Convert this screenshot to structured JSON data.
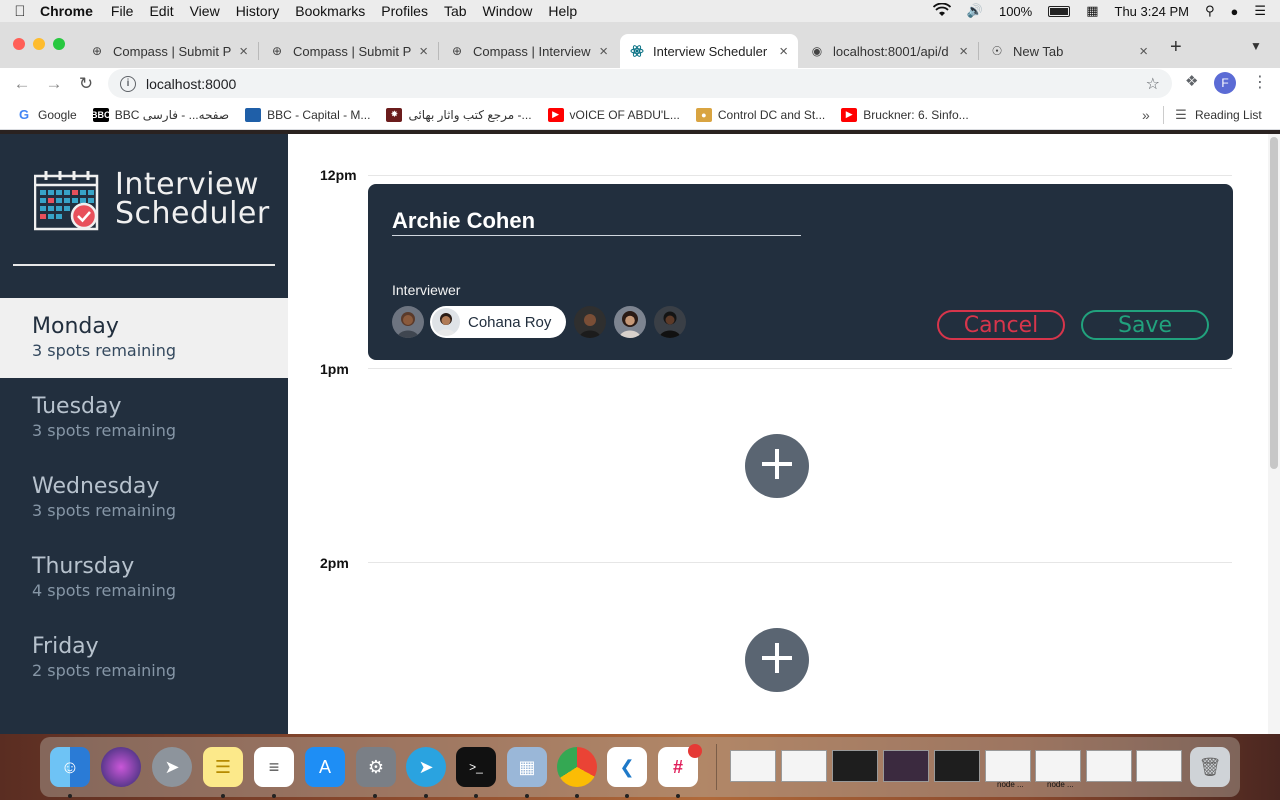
{
  "menubar": {
    "app": "Chrome",
    "items": [
      "File",
      "Edit",
      "View",
      "History",
      "Bookmarks",
      "Profiles",
      "Tab",
      "Window",
      "Help"
    ],
    "battery": "100%",
    "clock": "Thu 3:24 PM"
  },
  "tabs": [
    {
      "title": "Compass | Submit P",
      "icon": "compass-icon"
    },
    {
      "title": "Compass | Submit P",
      "icon": "compass-icon"
    },
    {
      "title": "Compass | Interview",
      "icon": "compass-icon"
    },
    {
      "title": "Interview Scheduler",
      "icon": "react-icon",
      "active": true
    },
    {
      "title": "localhost:8001/api/d",
      "icon": "globe-icon"
    },
    {
      "title": "New Tab",
      "icon": "chrome-icon"
    }
  ],
  "toolbar": {
    "url": "localhost:8000",
    "profile_initial": "F"
  },
  "bookmarks": [
    {
      "label": "Google",
      "icon": "google-icon",
      "color": "#4285f4"
    },
    {
      "label": "BBC صفحه... - فارسی",
      "icon": "bbc-icon",
      "color": "#000000"
    },
    {
      "label": "BBC - Capital - M...",
      "icon": "bbc-capital-icon",
      "color": "#1f5fa8"
    },
    {
      "label": "مرجع كتب واثار بهائى -...",
      "icon": "bahai-icon",
      "color": "#6b1c1c"
    },
    {
      "label": "vOICE OF ABDU'L...",
      "icon": "youtube-icon",
      "color": "#ff0000"
    },
    {
      "label": "Control DC and St...",
      "icon": "control-icon",
      "color": "#d9a441"
    },
    {
      "label": "Bruckner: 6. Sinfo...",
      "icon": "youtube-icon",
      "color": "#ff0000"
    }
  ],
  "reading_list": "Reading List",
  "app": {
    "brand_line1": "Interview",
    "brand_line2": "Scheduler",
    "days": [
      {
        "name": "Monday",
        "spots": "3 spots remaining",
        "selected": true
      },
      {
        "name": "Tuesday",
        "spots": "3 spots remaining"
      },
      {
        "name": "Wednesday",
        "spots": "3 spots remaining"
      },
      {
        "name": "Thursday",
        "spots": "4 spots remaining"
      },
      {
        "name": "Friday",
        "spots": "2 spots remaining"
      }
    ],
    "times": [
      "12pm",
      "1pm",
      "2pm"
    ],
    "form": {
      "student_name": "Archie Cohen",
      "interviewer_label": "Interviewer",
      "selected_interviewer": "Cohana Roy",
      "cancel_label": "Cancel",
      "save_label": "Save"
    }
  },
  "dock": {
    "apps": [
      "finder-icon",
      "siri-icon",
      "launchpad-icon",
      "notes-icon",
      "reminders-icon",
      "app-store-icon",
      "system-preferences-icon",
      "telegram-icon",
      "terminal-icon",
      "preview-icon",
      "chrome-icon",
      "vscode-icon",
      "slack-icon"
    ],
    "window_labels": [
      "node ...",
      "node ..."
    ]
  }
}
